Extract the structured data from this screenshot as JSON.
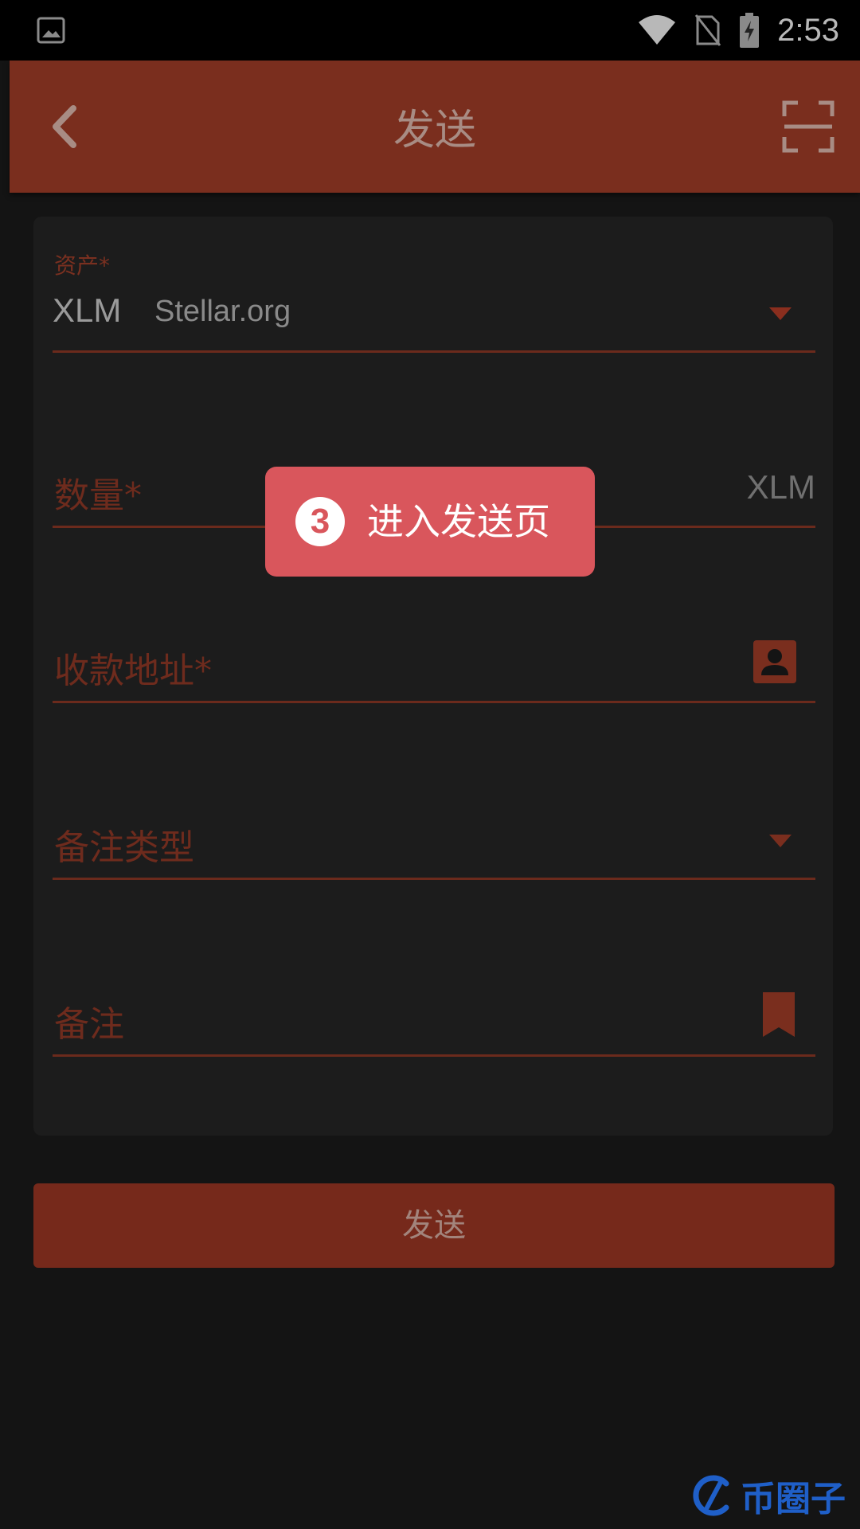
{
  "status_bar": {
    "time": "2:53",
    "icons": [
      "image-icon",
      "wifi-icon",
      "no-sim-icon",
      "battery-charging-icon"
    ]
  },
  "app_bar": {
    "title": "发送",
    "back_icon": "chevron-left-icon",
    "scan_icon": "scan-qr-icon"
  },
  "form": {
    "asset": {
      "label": "资产*",
      "code": "XLM",
      "issuer": "Stellar.org"
    },
    "amount": {
      "label": "数量*",
      "unit": "XLM"
    },
    "address": {
      "label": "收款地址*",
      "icon": "contact-icon"
    },
    "memo_type": {
      "label": "备注类型"
    },
    "memo": {
      "label": "备注",
      "icon": "bookmark-icon"
    }
  },
  "send_button": {
    "label": "发送"
  },
  "tooltip": {
    "step": "3",
    "text": "进入发送页"
  },
  "watermark": {
    "text": "币圈子"
  },
  "colors": {
    "accent": "#7a2e1e",
    "tooltip": "#d9565c",
    "background": "#141414",
    "card": "#1c1c1c",
    "watermark": "#1f5fc8"
  }
}
